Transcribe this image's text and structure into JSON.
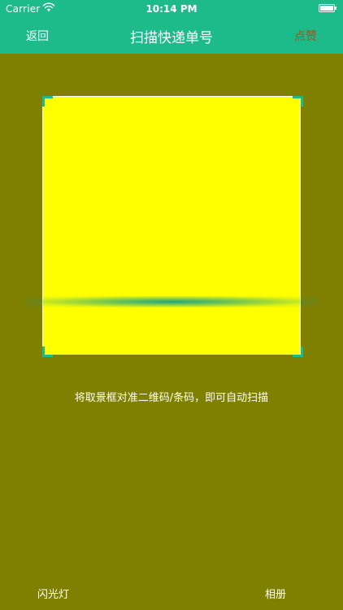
{
  "status_bar": {
    "carrier": "Carrier",
    "time": "10:14 PM",
    "wifi_icon": "wifi-icon",
    "battery_icon": "battery-icon"
  },
  "nav": {
    "back_label": "返回",
    "title": "扫描快递单号",
    "like_label": "点赞"
  },
  "scanner": {
    "hint": "将取景框对准二维码/条码，即可自动扫描"
  },
  "toolbar": {
    "flashlight_label": "闪光灯",
    "album_label": "相册"
  },
  "colors": {
    "nav_bg": "#1dbb8a",
    "page_bg": "#7f7f00",
    "scan_box": "#ffff00",
    "like_text": "#b24a1a",
    "scan_line": "#16a085"
  }
}
